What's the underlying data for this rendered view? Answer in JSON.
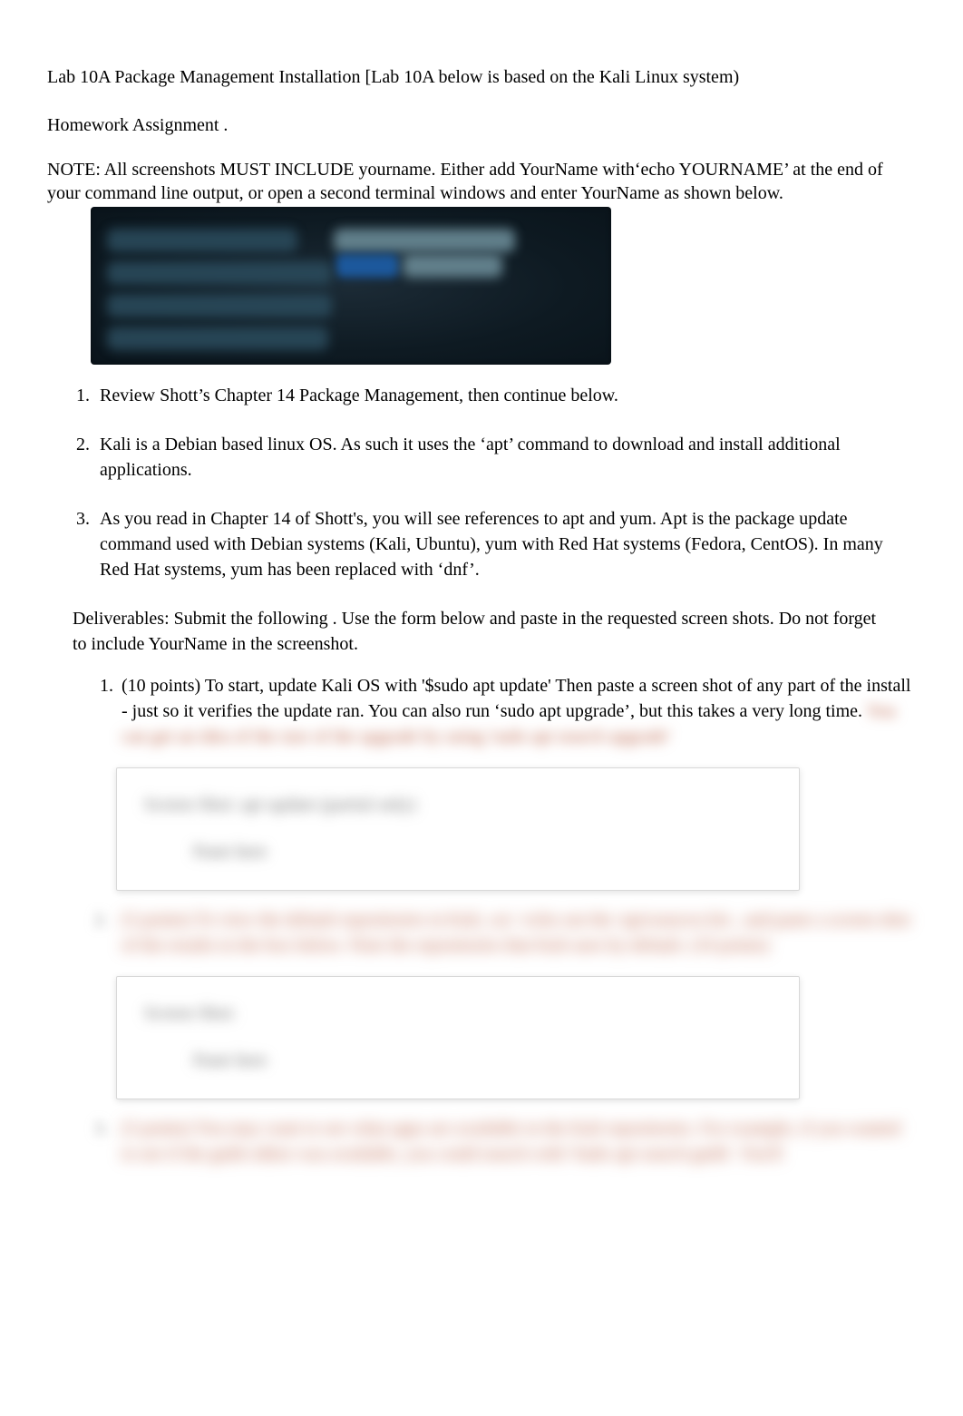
{
  "title": "Lab 10A Package Management Installation [Lab 10A below is based on the Kali Linux system)",
  "subtitle": " Homework Assignment  .",
  "note_lead": "            NOTE:  All screenshots MUST INCLUDE yourname.  Either add YourName with‘echo YOURNAME’ at the end of your command line output, or open a second terminal windows and enter YourName as shown below.",
  "list_items": [
    "Review Shott’s Chapter 14 Package Management, then continue below.",
    "Kali is a Debian based linux OS.  As such it uses the ‘apt’ command to download and install additional applications.",
    "As you read in Chapter 14 of Shott's, you will see references to apt and yum.  Apt is the package update command used with Debian systems (Kali, Ubuntu), yum with Red Hat systems (Fedora, CentOS).  In many Red Hat systems, yum has been replaced with ‘dnf’."
  ],
  "deliverables_intro": "Deliverables:   Submit the following .  Use the form below and paste in the requested screen shots.  Do not forget to include YourName in the screenshot.",
  "deliv1_visible": "(10 points) To start, update Kali OS with '$sudo apt update' Then paste a screen shot of any part of the install - just so it verifies the update ran. You can also run ‘sudo apt upgrade’, but this takes a very long time.   ",
  "deliv1_blurred_tail": "You can get an idea of the size of the upgrade by using 'sudo apt search upgrade'",
  "answer1_label": "Screen Shot: apt update (partial only)",
  "paste_here": "Paste here",
  "deliv2_blurred": "(5 points) To view the default repositories in Kali, cat / echo out the /apt/sources.list , and paste a screen shot of the results in the box below.  Note the repositories that Kali uses by default. (10 points)",
  "answer2_label": "Screen Shot:",
  "deliv3_blurred": "(5 points) You may want to see what apps are available in the Kali repositories.   For example, if you wanted to see if the gedit editor was available, you could search with 'Sudo apt search gedit'.  You'll"
}
